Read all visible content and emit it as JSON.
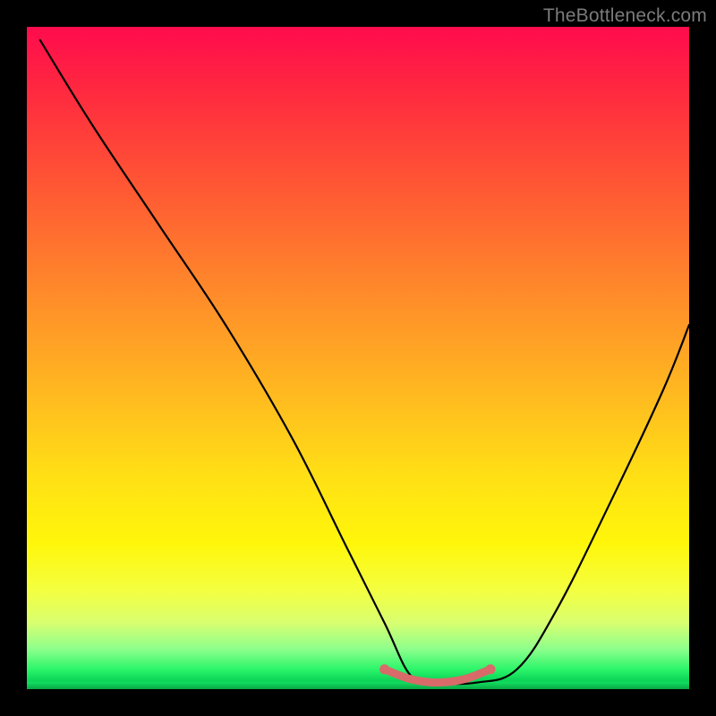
{
  "watermark": "TheBottleneck.com",
  "chart_data": {
    "type": "line",
    "title": "",
    "xlabel": "",
    "ylabel": "",
    "xlim": [
      0,
      100
    ],
    "ylim": [
      0,
      100
    ],
    "background_gradient": {
      "orientation": "vertical",
      "stops": [
        {
          "pos": 0,
          "color": "#ff0b4d"
        },
        {
          "pos": 25,
          "color": "#ff5a33"
        },
        {
          "pos": 55,
          "color": "#ffb820"
        },
        {
          "pos": 78,
          "color": "#fff60a"
        },
        {
          "pos": 94,
          "color": "#8cff8c"
        },
        {
          "pos": 100,
          "color": "#0ac850"
        }
      ]
    },
    "series": [
      {
        "name": "bottleneck-curve",
        "color": "#000000",
        "x": [
          2,
          10,
          20,
          30,
          40,
          48,
          54,
          58,
          62,
          68,
          74,
          80,
          88,
          96,
          100
        ],
        "y": [
          98,
          85,
          70,
          55,
          38,
          22,
          10,
          2,
          1,
          1,
          3,
          12,
          28,
          45,
          55
        ]
      }
    ],
    "highlight_segment": {
      "name": "optimal-flat-region",
      "color": "#d86a6a",
      "x": [
        54,
        58,
        62,
        66,
        70
      ],
      "y": [
        3,
        1.5,
        1,
        1.5,
        3
      ]
    }
  }
}
